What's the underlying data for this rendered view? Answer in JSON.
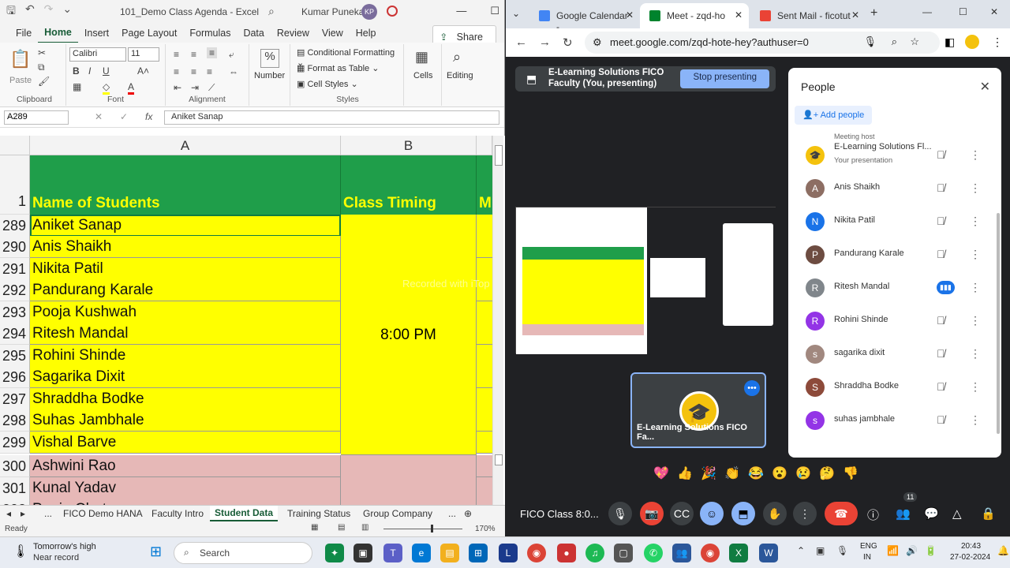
{
  "excel": {
    "doc_title": "101_Demo Class Agenda  -  Excel",
    "user_name": "Kumar Punekar",
    "user_initials": "KP",
    "tabs": [
      "File",
      "Home",
      "Insert",
      "Page Layout",
      "Formulas",
      "Data",
      "Review",
      "View",
      "Help"
    ],
    "active_tab": "Home",
    "share_label": "Share",
    "ribbon": {
      "paste": "Paste",
      "clipboard": "Clipboard",
      "font_name": "Calibri",
      "font_size": "11",
      "font": "Font",
      "alignment": "Alignment",
      "number": "Number",
      "percent": "%",
      "cond_format": "Conditional Formatting",
      "format_table": "Format as Table",
      "cell_styles": "Cell Styles",
      "styles": "Styles",
      "cells": "Cells",
      "editing": "Editing"
    },
    "name_box": "A289",
    "formula": "Aniket Sanap",
    "col_headers": [
      "A",
      "B"
    ],
    "header_row_num": "1",
    "header_a": "Name of Students",
    "header_b": "Class Timing",
    "header_c": "M",
    "rows": [
      {
        "num": "289",
        "name": "Aniket Sanap"
      },
      {
        "num": "290",
        "name": "Anis Shaikh"
      },
      {
        "num": "291",
        "name": "Nikita Patil"
      },
      {
        "num": "292",
        "name": "Pandurang Karale"
      },
      {
        "num": "293",
        "name": "Pooja Kushwah"
      },
      {
        "num": "294",
        "name": "Ritesh Mandal"
      },
      {
        "num": "295",
        "name": "Rohini Shinde"
      },
      {
        "num": "296",
        "name": "Sagarika Dixit"
      },
      {
        "num": "297",
        "name": "Shraddha Bodke"
      },
      {
        "num": "298",
        "name": "Suhas Jambhale"
      },
      {
        "num": "299",
        "name": "Vishal Barve"
      },
      {
        "num": "300",
        "name": "Ashwini Rao"
      },
      {
        "num": "301",
        "name": "Kunal Yadav"
      },
      {
        "num": "302",
        "name": "Pooja Chot"
      }
    ],
    "class_timing": "8:00 PM",
    "sheet_tabs": [
      "...",
      "FICO Demo HANA",
      "Faculty Intro",
      "Student Data",
      "Training Status",
      "Group Company",
      "..."
    ],
    "active_sheet": "Student Data",
    "status_ready": "Ready",
    "zoom": "170%",
    "colors": {
      "header_green": "#1f9e4a",
      "header_text": "#ffff00",
      "yellow": "#ffff00",
      "pink": "#e6b8b7"
    }
  },
  "chrome": {
    "tabs": [
      {
        "label": "Google Calendar -",
        "color": "#4285f4"
      },
      {
        "label": "Meet - zqd-ho",
        "color": "#00832d"
      },
      {
        "label": "Sent Mail - ficotut",
        "color": "#ea4335"
      }
    ],
    "url": "meet.google.com/zqd-hote-hey?authuser=0"
  },
  "meet": {
    "presenting_line1": "E-Learning Solutions FICO",
    "presenting_line2": "Faculty (You, presenting)",
    "stop_label": "Stop presenting",
    "watermark": "Recorded with iTop Screen Recorder",
    "tile_name": "E-Learning Solutions FICO Fa...",
    "meeting_name": "FICO Class 8:0...",
    "participant_count": "11",
    "emojis": [
      "💖",
      "👍",
      "🎉",
      "👏",
      "😂",
      "😮",
      "😢",
      "🤔",
      "👎"
    ],
    "people_title": "People",
    "add_people": "Add people",
    "meeting_host": "Meeting host",
    "participants": [
      {
        "name": "E-Learning Solutions Fl...",
        "sub": "Your presentation",
        "initial": "🎓",
        "color": "#f4c20d"
      },
      {
        "name": "Anis Shaikh",
        "initial": "A",
        "color": "#8d6e63"
      },
      {
        "name": "Nikita Patil",
        "initial": "N",
        "color": "#1a73e8"
      },
      {
        "name": "Pandurang Karale",
        "initial": "P",
        "color": "#6d4c41"
      },
      {
        "name": "Ritesh Mandal",
        "initial": "R",
        "color": "#80868b"
      },
      {
        "name": "Rohini Shinde",
        "initial": "R",
        "color": "#9334e6"
      },
      {
        "name": "sagarika dixit",
        "initial": "s",
        "color": "#a1887f"
      },
      {
        "name": "Shraddha Bodke",
        "initial": "S",
        "color": "#8d4a3a"
      },
      {
        "name": "suhas jambhale",
        "initial": "s",
        "color": "#9334e6"
      }
    ]
  },
  "taskbar": {
    "weather_line1": "Tomorrow's high",
    "weather_line2": "Near record",
    "search": "Search",
    "lang1": "ENG",
    "lang2": "IN",
    "time": "20:43",
    "date": "27-02-2024"
  }
}
